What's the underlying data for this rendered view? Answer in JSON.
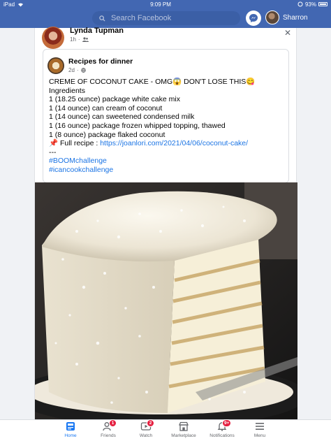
{
  "status_bar": {
    "device": "iPad",
    "time": "9:09 PM",
    "battery": "93%"
  },
  "top_bar": {
    "search_placeholder": "Search Facebook",
    "user_name": "Sharron"
  },
  "post": {
    "author": "Lynda Tupman",
    "time": "1h",
    "shared": {
      "group": "Recipes for dinner",
      "time": "2d",
      "lines": [
        "CREME OF COCONUT CAKE - OMG😱 DON'T LOSE THIS😋",
        "Ingredients",
        "1 (18.25 ounce) package white cake mix",
        "1 (14 ounce) can cream of coconut",
        "1 (14 ounce) can sweetened condensed milk",
        "1 (16 ounce) package frozen whipped topping, thawed",
        "1 (8 ounce) package flaked coconut"
      ],
      "recipe_prefix": "📌 Full recipe : ",
      "recipe_link": "https://joanlori.com/2021/04/06/coconut-cake/",
      "separator": "---",
      "hashtags": [
        "#BOOMchallenge",
        "#icancookchallenge"
      ]
    }
  },
  "tabs": [
    {
      "label": "Home",
      "badge": ""
    },
    {
      "label": "Friends",
      "badge": "1"
    },
    {
      "label": "Watch",
      "badge": "2"
    },
    {
      "label": "Marketplace",
      "badge": ""
    },
    {
      "label": "Notifications",
      "badge": "9+"
    },
    {
      "label": "Menu",
      "badge": ""
    }
  ],
  "colors": {
    "brand": "#4267b2",
    "link": "#1b74e4",
    "active_tab": "#1877f2",
    "badge": "#e41e3f"
  }
}
